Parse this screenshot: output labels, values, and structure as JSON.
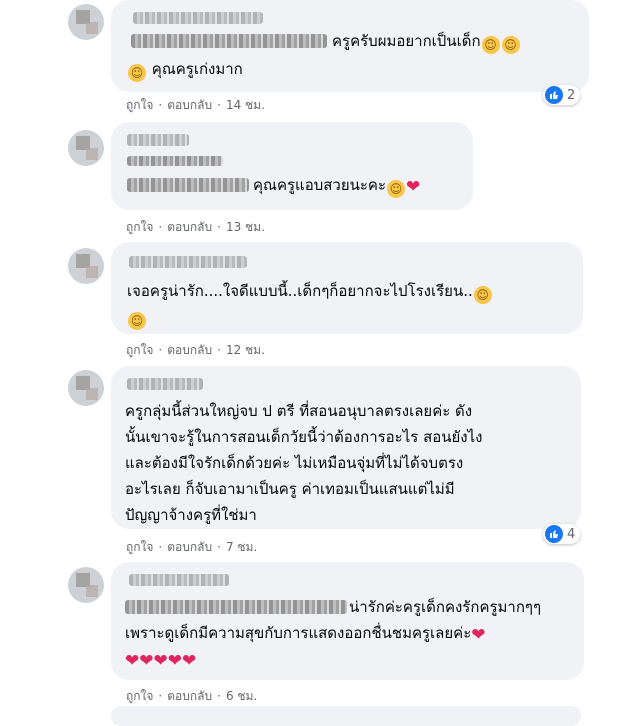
{
  "comments": [
    {
      "text_line1": "ครูครับผมอยากเป็นเด็ก",
      "text_line2": "คุณครูเก่งมาก",
      "emoji": "☺",
      "like_label": "ถูกใจ",
      "reply_label": "ตอบกลับ",
      "time": "14 ชม.",
      "reaction_count": "2"
    },
    {
      "text_line1": "คุณครูแอบสวยนะคะ",
      "emoji_love": "☺",
      "heart": "❤",
      "like_label": "ถูกใจ",
      "reply_label": "ตอบกลับ",
      "time": "13 ชม."
    },
    {
      "text_line1": "เจอครูน่ารัก....ใจดีแบบนี้..เด็กๆก็อยากจะไปโรงเรียน..",
      "emoji": "☺",
      "like_label": "ถูกใจ",
      "reply_label": "ตอบกลับ",
      "time": "12 ชม."
    },
    {
      "text_line1": "ครูกลุ่มนี้ส่วนใหญ่จบ ป ตรี ที่สอนอนุบาลตรงเลยค่ะ ดัง",
      "text_line2": "นั้นเขาจะรู้ในการสอนเด็กวัยนี้ว่าต้องการอะไร สอนยังไง",
      "text_line3": "และต้องมีใจรักเด็กด้วยค่ะ ไม่เหมือนจุ่มที่ไม่ได้จบตรง",
      "text_line4": "อะไรเลย ก็จับเอามาเป็นครู ค่าเทอมเป็นแสนแต่ไม่มี",
      "text_line5": "ปัญญาจ้างครูที่ใช่มา",
      "like_label": "ถูกใจ",
      "reply_label": "ตอบกลับ",
      "time": "7 ชม.",
      "reaction_count": "4"
    },
    {
      "text_line1": "น่ารักค่ะครูเด็กคงรักครูมากๆๆ",
      "text_line2": "เพราะดูเด็กมีความสุขกับการแสดงออกชื่นชมครูเลยค่ะ",
      "heart": "❤",
      "like_label": "ถูกใจ",
      "reply_label": "ตอบกลับ",
      "time": "6 ชม."
    }
  ],
  "separator": "·",
  "colors": {
    "bubble": "#f0f2f5",
    "meta_text": "#65676b",
    "like_blue": "#1877f2",
    "heart_red": "#e0245e",
    "emoji_yellow": "#f7c64b"
  },
  "icons": {
    "like": "like-reaction-icon",
    "smile": "smiling-face-emoji",
    "heart": "heart-emoji"
  }
}
